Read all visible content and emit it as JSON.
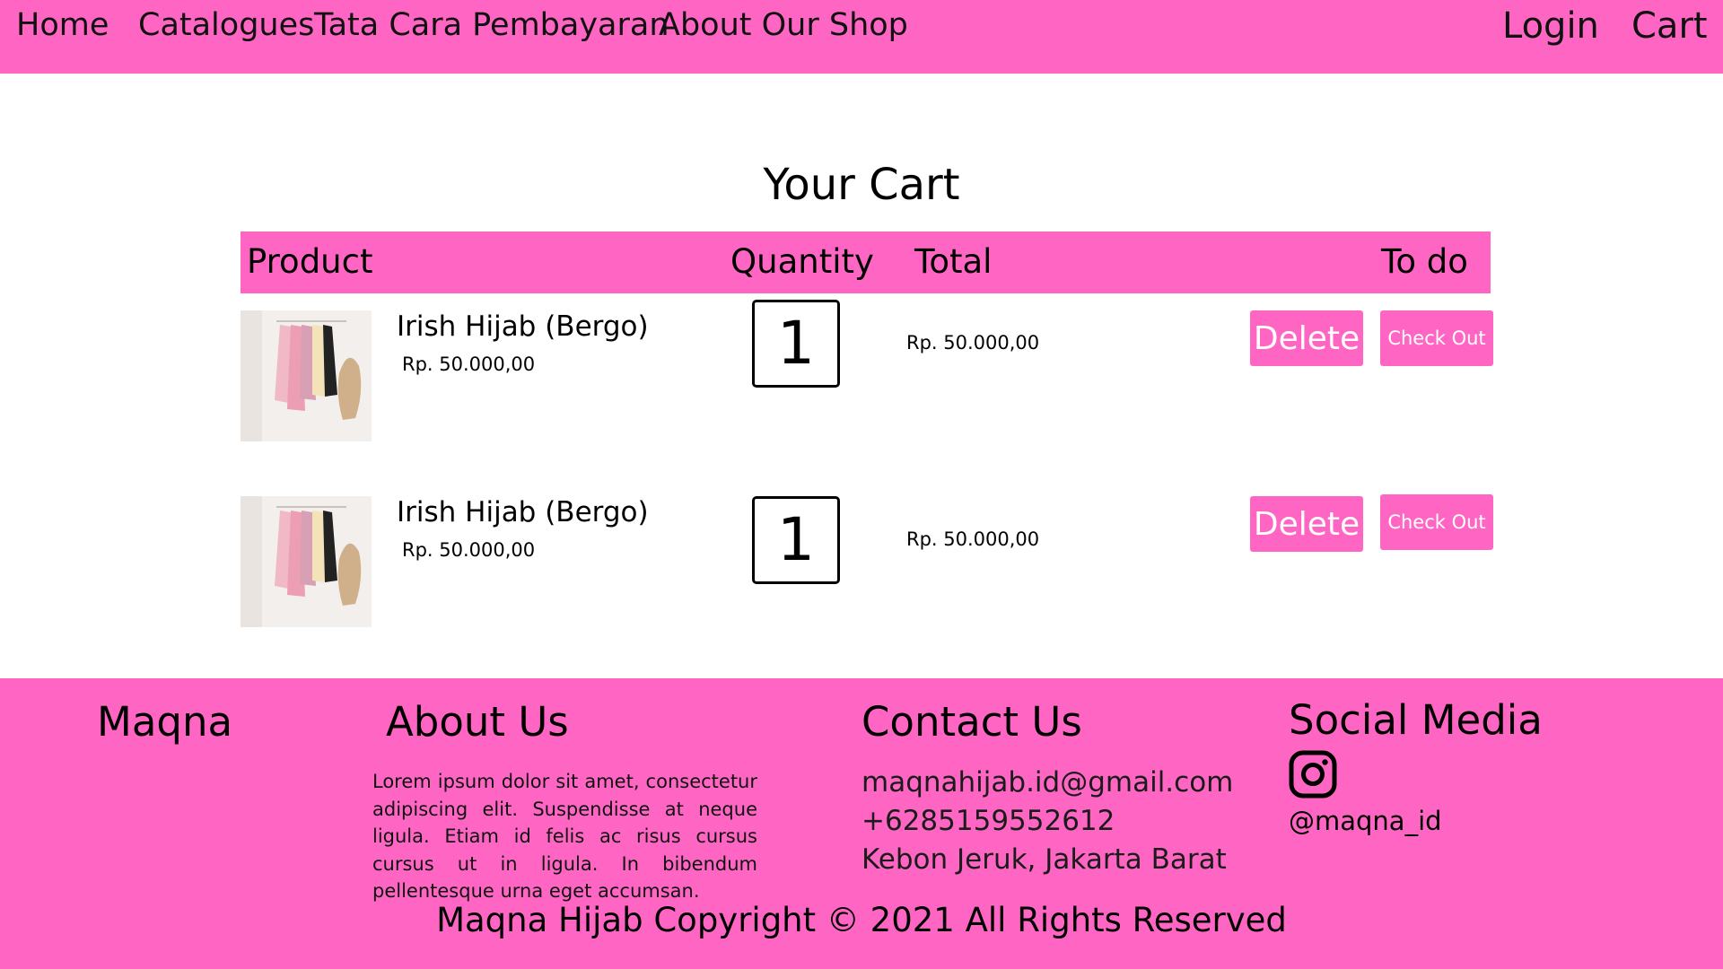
{
  "nav": {
    "home": "Home",
    "catalogues": "Catalogues",
    "payment": "Tata Cara Pembayaran",
    "about": "About Our Shop",
    "login": "Login",
    "cart": "Cart"
  },
  "page_title": "Your Cart",
  "table_header": {
    "product": "Product",
    "quantity": "Quantity",
    "total": "Total",
    "todo": "To do"
  },
  "cart_items": [
    {
      "name": "Irish Hijab (Bergo)",
      "price": "Rp. 50.000,00",
      "quantity": "1",
      "total": "Rp. 50.000,00",
      "delete_label": "Delete",
      "checkout_label": "Check Out"
    },
    {
      "name": "Irish Hijab (Bergo)",
      "price": "Rp. 50.000,00",
      "quantity": "1",
      "total": "Rp. 50.000,00",
      "delete_label": "Delete",
      "checkout_label": "Check Out"
    }
  ],
  "footer": {
    "brand": "Maqna",
    "about_title": "About Us",
    "about_text": "Lorem ipsum dolor sit amet, consectetur adipiscing elit. Suspendisse at neque ligula. Etiam id felis ac risus cursus cursus ut in ligula. In bibendum pellentesque urna eget accumsan.",
    "contact_title": "Contact Us",
    "email": "maqnahijab.id@gmail.com",
    "phone": "+6285159552612",
    "address": "Kebon Jeruk, Jakarta Barat",
    "social_title": "Social Media",
    "instagram_icon": "instagram-icon",
    "instagram_handle": "@maqna_id",
    "copyright": "Maqna Hijab Copyright © 2021 All Rights Reserved"
  },
  "colors": {
    "brand_pink": "#ff66c4",
    "button_text": "#ffffff"
  }
}
